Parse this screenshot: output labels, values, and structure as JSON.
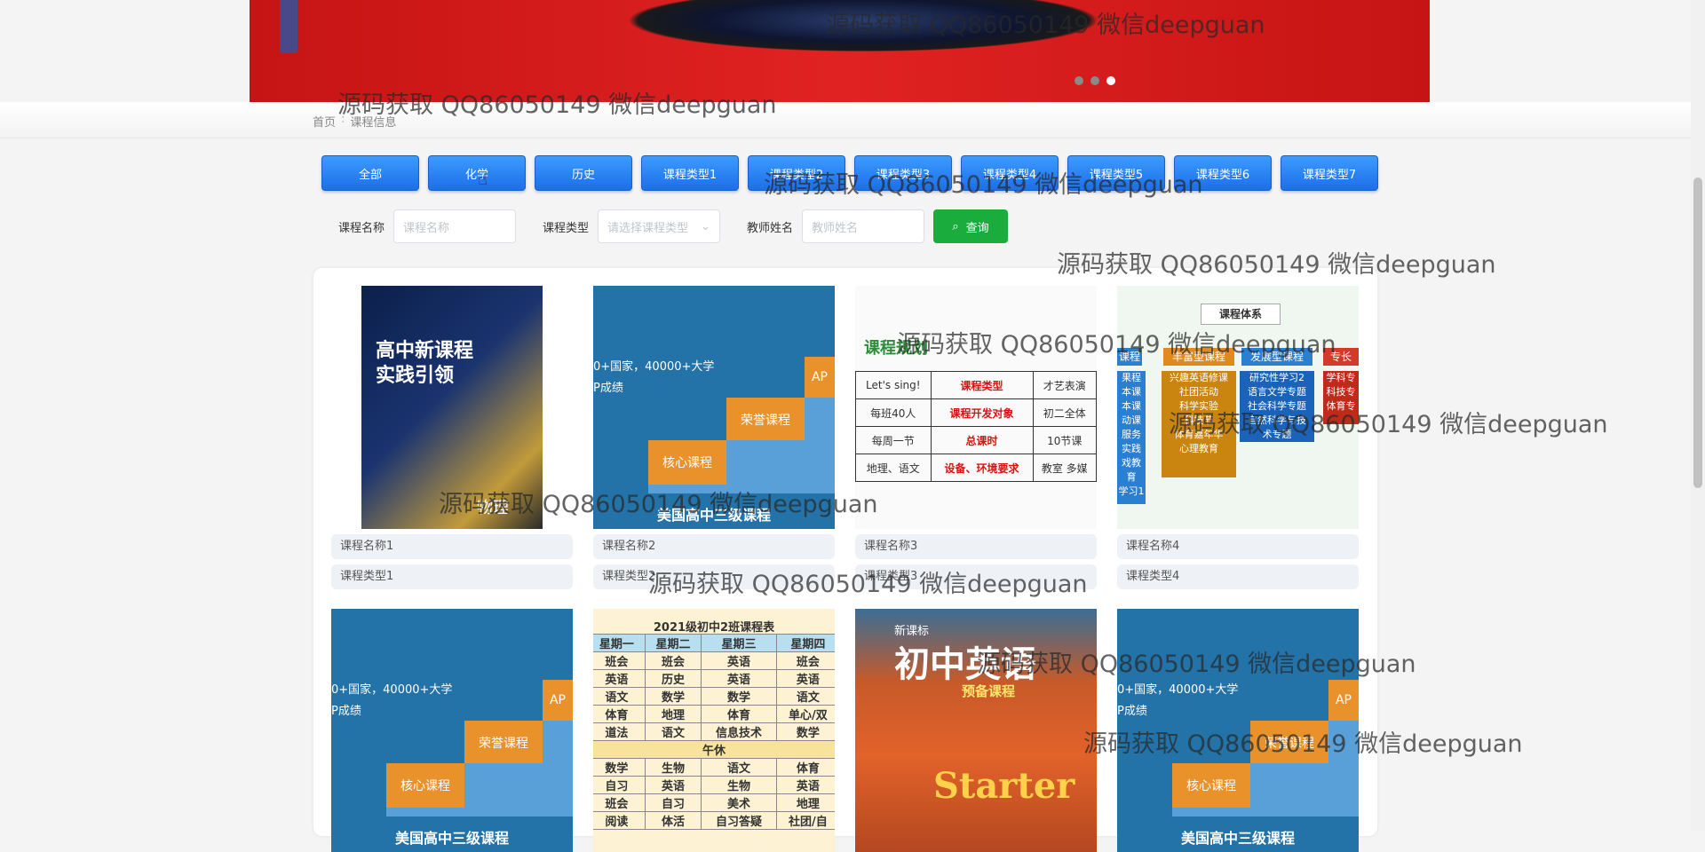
{
  "banner": {
    "active_dot": 2
  },
  "breadcrumb": {
    "home": "首页",
    "sep": ":",
    "current": "课程信息"
  },
  "categories": [
    "全部",
    "化学",
    "历史",
    "课程类型1",
    "课程类型2",
    "课程类型3",
    "课程类型4",
    "课程类型5",
    "课程类型6",
    "课程类型7"
  ],
  "search": {
    "name_label": "课程名称",
    "name_placeholder": "课程名称",
    "type_label": "课程类型",
    "type_placeholder": "请选择课程类型",
    "teacher_label": "教师姓名",
    "teacher_placeholder": "教师姓名",
    "query_label": "查询"
  },
  "cards": [
    {
      "name": "课程名称1",
      "type": "课程类型1"
    },
    {
      "name": "课程名称2",
      "type": "课程类型2"
    },
    {
      "name": "课程名称3",
      "type": "课程类型3"
    },
    {
      "name": "课程名称4",
      "type": "课程类型4"
    }
  ],
  "images": {
    "physics": {
      "title": "高中新课程\n实践引领",
      "subject": "物理"
    },
    "us": {
      "line1": "0+国家，40000+大学",
      "line2": "P成绩",
      "honors": "荣誉课程",
      "core": "核心课程",
      "ap": "AP",
      "footer": "美国高中三级课程"
    },
    "plan": {
      "title": "课程规划",
      "rows": [
        [
          "Let's sing!",
          "课程类型",
          "才艺表演"
        ],
        [
          "每班40人",
          "课程开发对象",
          "初二全体"
        ],
        [
          "每周一节",
          "总课时",
          "10节课"
        ],
        [
          "地理、语文",
          "设备、环境要求",
          "教室 多媒"
        ]
      ]
    },
    "system": {
      "title": "课程体系",
      "headers": [
        "课程",
        "丰富型课程",
        "发展型课程",
        "专长"
      ],
      "col1": "果程\n本课\n本课\n动课\n服务\n实践\n戏教育\n学习1",
      "col2": "兴趣英语修课\n社团活动\n科学实验\n科技节\n体育嘉年华\n心理教育",
      "col3": "研究性学习2\n语言文学专题\n社会科学专题\n自然科学与技\n术专题",
      "col4": "学科专\n科技专\n体育专"
    },
    "schedule": {
      "title": "2021级初中2班课程表",
      "header": [
        "星期一",
        "星期二",
        "星期三",
        "星期四"
      ],
      "rows1": [
        [
          "班会",
          "班会",
          "英语",
          "班会"
        ],
        [
          "英语",
          "历史",
          "英语",
          "英语"
        ],
        [
          "语文",
          "数学",
          "数学",
          "语文"
        ],
        [
          "体育",
          "地理",
          "体育",
          "单心/双"
        ],
        [
          "道法",
          "语文",
          "信息技术",
          "数学"
        ]
      ],
      "noon": "午休",
      "rows2": [
        [
          "数学",
          "生物",
          "语文",
          "体育"
        ],
        [
          "自习",
          "英语",
          "生物",
          "英语"
        ],
        [
          "班会",
          "自习",
          "美术",
          "地理"
        ],
        [
          "阅读",
          "体活",
          "自习答疑",
          "社团/自"
        ]
      ]
    },
    "english": {
      "tag": "新课标",
      "title": "初中英语",
      "sub": "预备课程",
      "word": "Starter"
    }
  },
  "watermark": "源码获取 QQ86050149 微信deepguan"
}
